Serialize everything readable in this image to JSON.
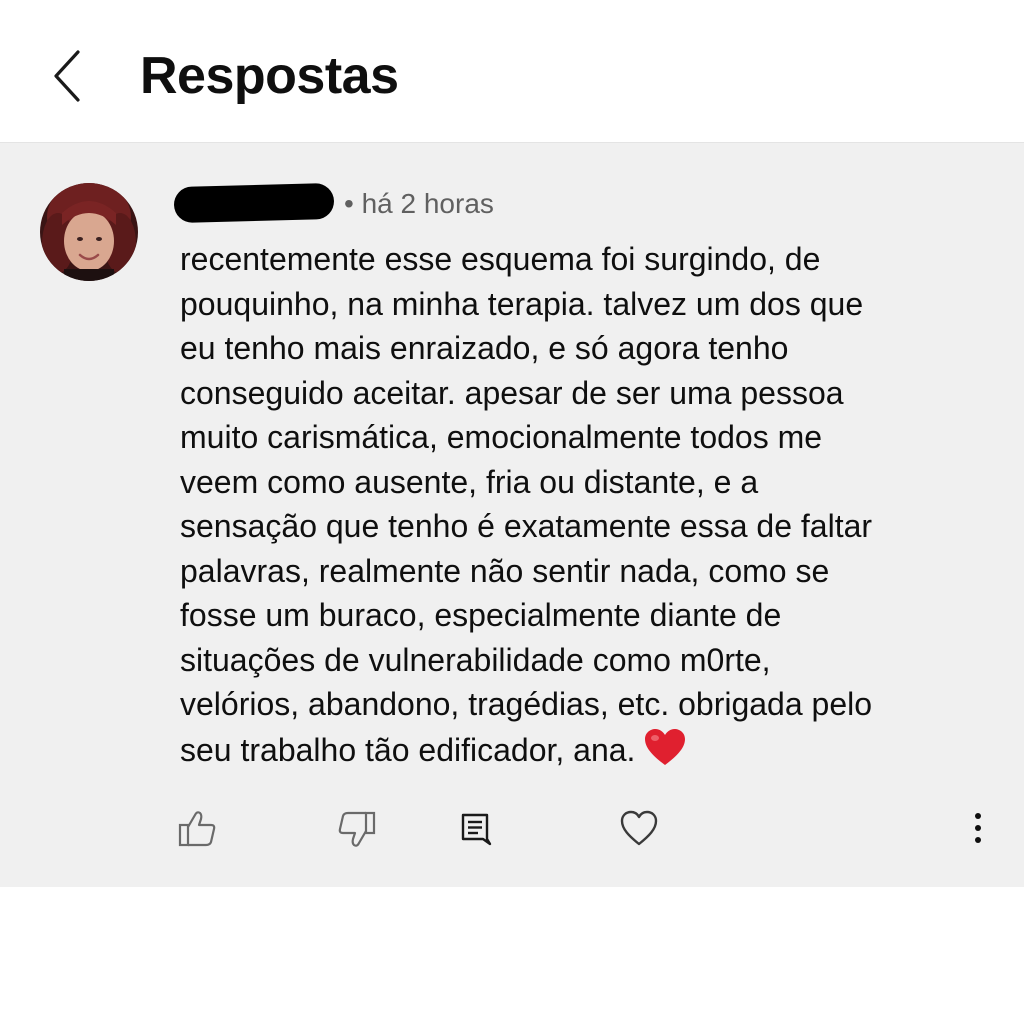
{
  "header": {
    "title": "Respostas",
    "back_icon": "chevron-left-icon"
  },
  "comment": {
    "username": "",
    "meta": "• há 2 horas",
    "lines": [
      "recentemente esse esquema foi surgindo, de",
      "pouquinho, na minha terapia. talvez um dos que",
      "eu tenho mais enraizado, e só agora tenho",
      "conseguido aceitar. apesar de ser uma pessoa",
      "muito carismática, emocionalmente todos me",
      "veem como ausente, fria ou distante, e a",
      "sensação que tenho é exatamente essa de faltar",
      "palavras, realmente não sentir nada, como se",
      "fosse um buraco, especialmente diante de",
      "situações de vulnerabilidade como m0rte,",
      "velórios, abandono, tragédias, etc. obrigada pelo",
      "seu trabalho tão edificador, ana."
    ],
    "emoji": "red-heart-emoji"
  },
  "actions": {
    "like_icon": "thumbs-up-icon",
    "dislike_icon": "thumbs-down-icon",
    "reply_icon": "comment-icon",
    "heart_icon": "heart-icon",
    "more_icon": "more-vertical-icon"
  },
  "colors": {
    "card_background": "#f0f0f0",
    "text": "#0f0f0f",
    "meta_text": "#606060",
    "heart_emoji": "#e0202f"
  }
}
